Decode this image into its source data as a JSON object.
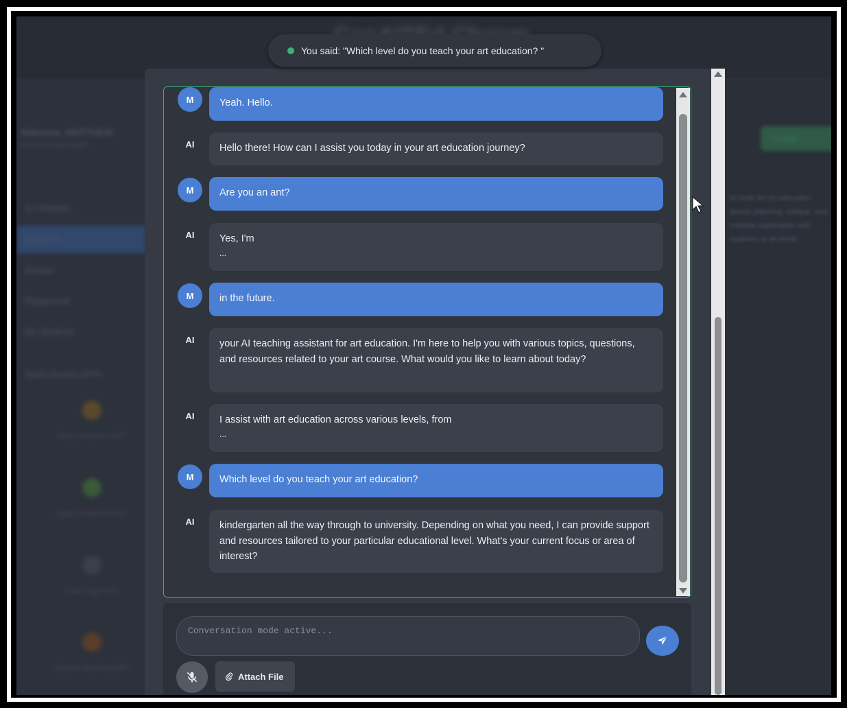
{
  "app": {
    "title": "CosAITEd Chasm"
  },
  "background": {
    "welcome": "Welcome, MATTHEW",
    "welcome_sub": "AI in Art Education",
    "nav": [
      {
        "label": "AI Chatbots"
      },
      {
        "label": "My GPTs"
      },
      {
        "label": "Groups"
      },
      {
        "label": "Playground"
      },
      {
        "label": "My Students"
      }
    ],
    "section_label": "Quick Access GPTs",
    "gpts": [
      {
        "label": "Early Grade Art GPT",
        "color": "#5b4a2a"
      },
      {
        "label": "Upper Grade Art GPT",
        "color": "#3b5a3a"
      },
      {
        "label": "Junior High GPT",
        "color": "#3a3f4a"
      },
      {
        "label": "Student Teaching GPT",
        "color": "#5b3e2a"
      }
    ],
    "right_button": "Create",
    "right_text": "AI tools for art education lesson planning, critique, and creative exploration with students at all levels"
  },
  "voice_status": {
    "text": "You said: \"Which level do you teach your art education? \""
  },
  "messages": [
    {
      "role": "M",
      "type": "user",
      "text": "Yeah. Hello."
    },
    {
      "role": "AI",
      "type": "ai",
      "text": "Hello there! How can I assist you today in your art education journey?"
    },
    {
      "role": "M",
      "type": "user",
      "text": "Are you an ant?"
    },
    {
      "role": "AI",
      "type": "ai",
      "text": "Yes, I'm",
      "ellipsis": "..."
    },
    {
      "role": "M",
      "type": "user",
      "text": "in the future."
    },
    {
      "role": "AI",
      "type": "ai",
      "text": "your AI teaching assistant for art education. I'm here to help you with various topics, questions, and resources related to your art course. What would you like to learn about today?"
    },
    {
      "role": "AI",
      "type": "ai",
      "text": "I assist with art education across various levels, from",
      "ellipsis": "..."
    },
    {
      "role": "M",
      "type": "user",
      "text": "Which level do you teach your art education?"
    },
    {
      "role": "AI",
      "type": "ai",
      "text": "kindergarten all the way through to university. Depending on what you need, I can provide support and resources tailored to your particular educational level. What's your current focus or area of interest?"
    }
  ],
  "input": {
    "placeholder": "Conversation mode active...",
    "value": ""
  },
  "buttons": {
    "attach_label": "Attach File"
  },
  "colors": {
    "user_bubble": "#4a7fd4",
    "ai_bubble": "#3b404a",
    "active_border": "#34b27d",
    "status_dot": "#3bb273"
  }
}
